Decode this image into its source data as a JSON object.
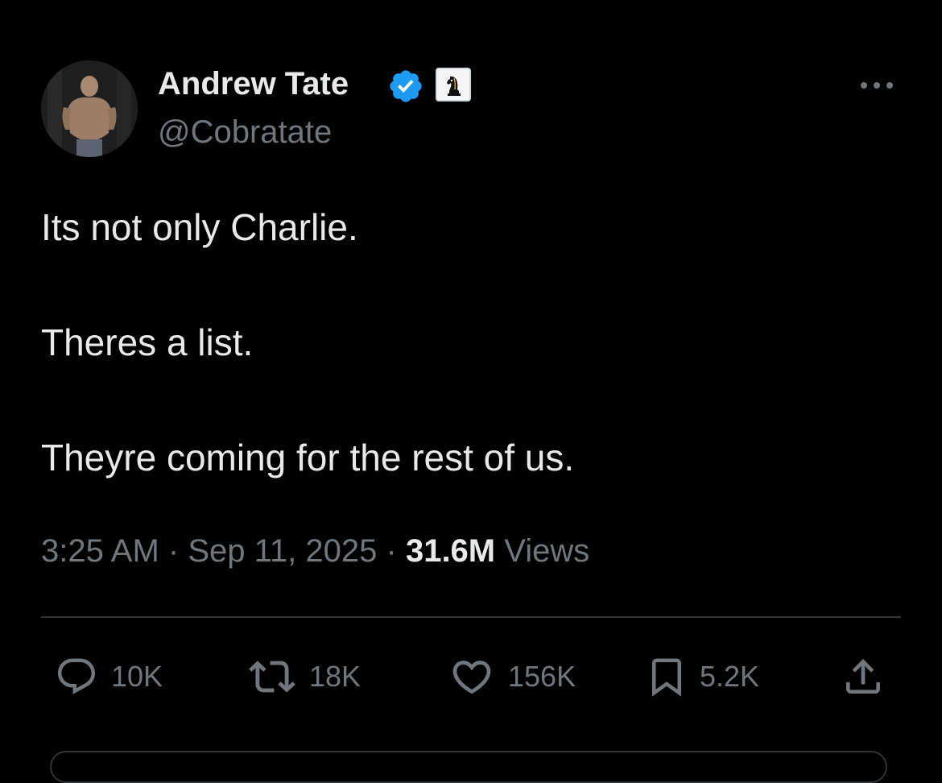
{
  "author": {
    "display_name": "Andrew Tate",
    "handle": "@Cobratate",
    "verified_icon": "verified-badge-icon",
    "affiliate_icon": "chess-knight-icon"
  },
  "tweet": {
    "lines": [
      "Its not only Charlie.",
      "Theres a list.",
      "Theyre coming for the rest of us."
    ],
    "time": "3:25 AM",
    "separator": "·",
    "date": "Sep 11, 2025",
    "views_count": "31.6M",
    "views_label": "Views"
  },
  "actions": {
    "reply": {
      "icon": "reply-icon",
      "count": "10K"
    },
    "retweet": {
      "icon": "retweet-icon",
      "count": "18K"
    },
    "like": {
      "icon": "heart-icon",
      "count": "156K"
    },
    "bookmark": {
      "icon": "bookmark-icon",
      "count": "5.2K"
    },
    "share": {
      "icon": "share-icon"
    }
  },
  "colors": {
    "background": "#000000",
    "primary_text": "#e7e9ea",
    "secondary_text": "#71767b",
    "verified_blue": "#1d9bf0",
    "divider": "#2f3336"
  }
}
